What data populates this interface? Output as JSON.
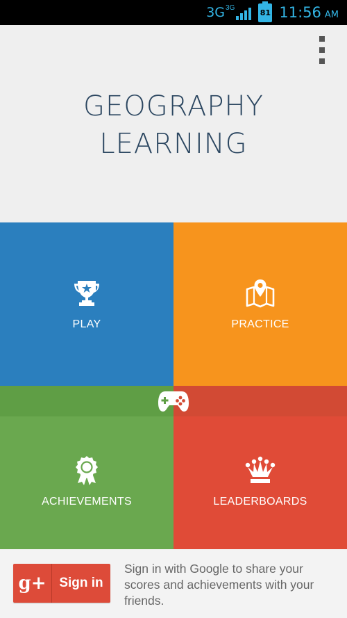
{
  "status_bar": {
    "network": "3G",
    "network_small": "3G",
    "signal_bars": 4,
    "battery_level": "81",
    "time": "11:56",
    "ampm": "AM",
    "accent_color": "#33b5e5"
  },
  "header": {
    "title_line1": "GEOGRAPHY",
    "title_line2": "LEARNING",
    "menu_icon": "overflow-menu-icon"
  },
  "tiles": [
    {
      "label": "PLAY",
      "icon": "trophy-icon",
      "color": "#2b7fbe"
    },
    {
      "label": "PRACTICE",
      "icon": "map-pin-icon",
      "color": "#f7941d"
    },
    {
      "label": "ACHIEVEMENTS",
      "icon": "award-ribbon-icon",
      "color": "#6aa84f"
    },
    {
      "label": "LEADERBOARDS",
      "icon": "crown-icon",
      "color": "#e04b37"
    }
  ],
  "center_icon": "gamepad-icon",
  "signin": {
    "gplus_label": "g+",
    "button_label": "Sign in",
    "description": "Sign in with Google to share your scores and achievements with your friends.",
    "button_color": "#dd4b39"
  }
}
